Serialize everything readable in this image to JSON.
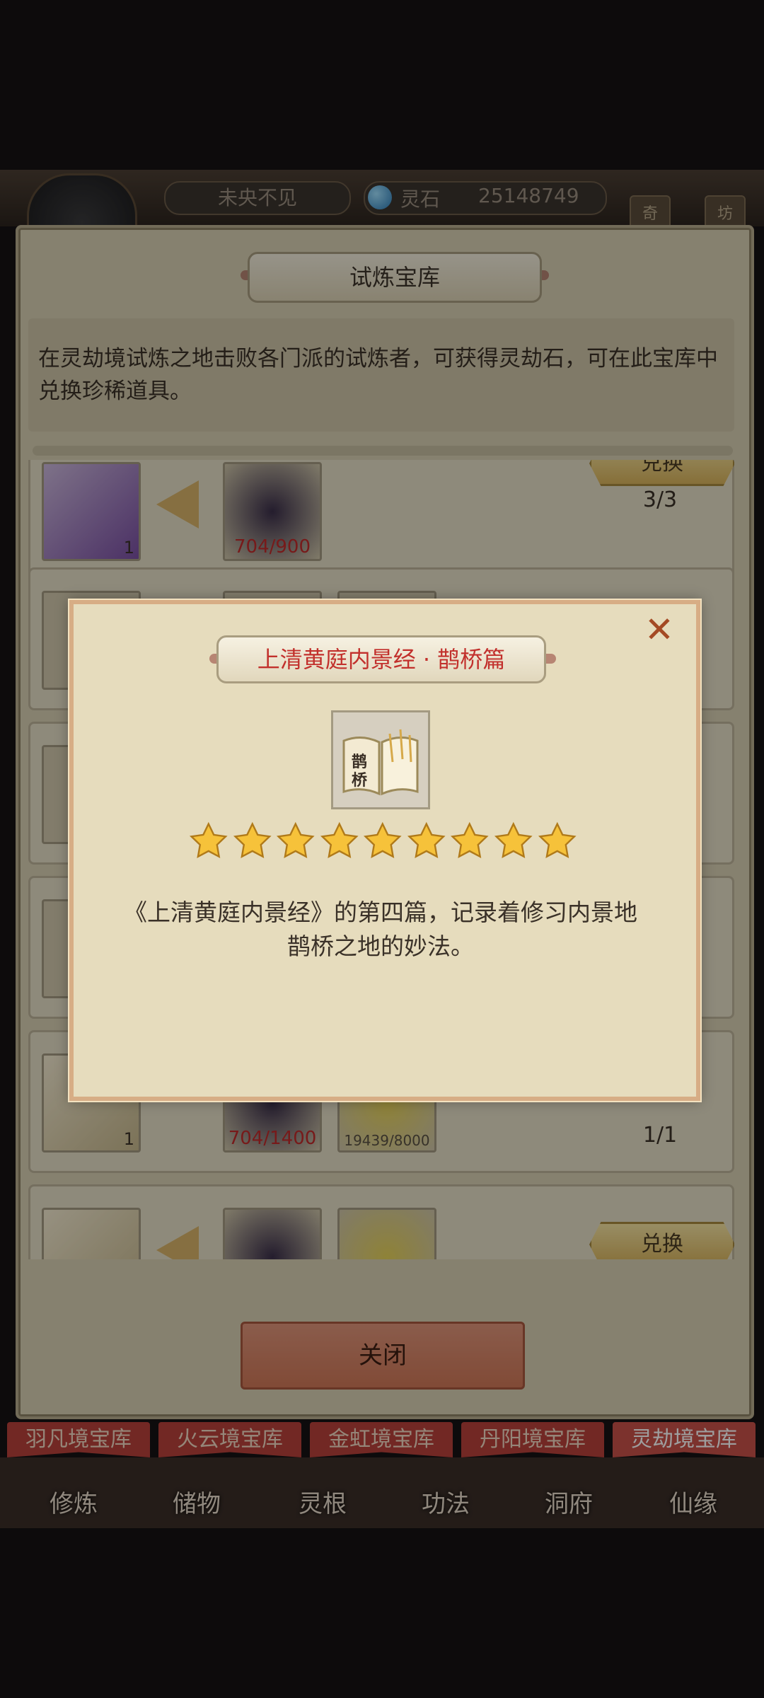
{
  "topbar": {
    "player_name": "未央不见",
    "currency_name": "灵石",
    "currency_value": "25148749",
    "tag1": "奇",
    "tag2": "坊"
  },
  "panel": {
    "title": "试炼宝库",
    "description": "在灵劫境试炼之地击败各门派的试炼者，可获得灵劫石，可在此宝库中兑换珍稀道具。",
    "rows": [
      {
        "target_count": "1",
        "cost1": "704/900",
        "button": "兑换",
        "limit": "3/3"
      },
      {
        "target_count": "1",
        "cost1": "704/1400",
        "cost2": "19439/8000",
        "limit": "1/1"
      },
      {
        "button": "兑换"
      }
    ],
    "close_button": "关闭"
  },
  "tabs": [
    "羽凡境宝库",
    "火云境宝库",
    "金虹境宝库",
    "丹阳境宝库",
    "灵劫境宝库"
  ],
  "nav": [
    "修炼",
    "储物",
    "灵根",
    "功法",
    "洞府",
    "仙缘"
  ],
  "modal": {
    "title": "上清黄庭内景经 · 鹊桥篇",
    "item_glyph_1": "鹊",
    "item_glyph_2": "桥",
    "star_count": 9,
    "description_line1": "《上清黄庭内景经》的第四篇，记录着修习内景地",
    "description_line2": "鹊桥之地的妙法。"
  },
  "colors": {
    "accent_red": "#c2302c",
    "gold": "#d9b45c",
    "modal_border": "#d7ad85"
  }
}
